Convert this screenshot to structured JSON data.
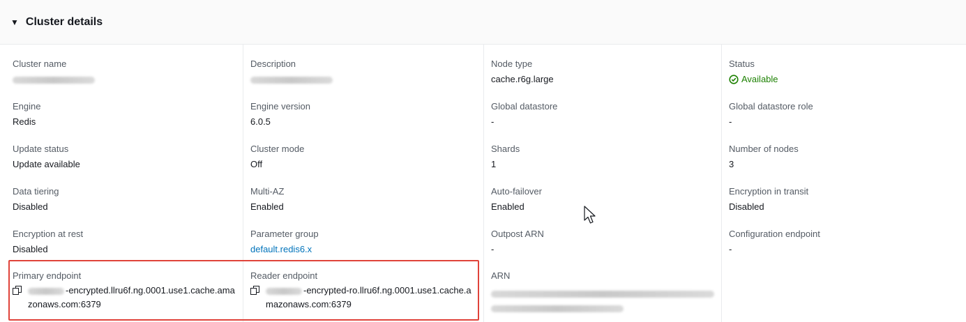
{
  "header": {
    "caret": "▼",
    "title": "Cluster details"
  },
  "columns": [
    {
      "fields": [
        {
          "label": "Cluster name",
          "value": ""
        },
        {
          "label": "Engine",
          "value": "Redis"
        },
        {
          "label": "Update status",
          "value": "Update available"
        },
        {
          "label": "Data tiering",
          "value": "Disabled"
        },
        {
          "label": "Encryption at rest",
          "value": "Disabled"
        },
        {
          "label": "Primary endpoint",
          "value": "-encrypted.llru6f.ng.0001.use1.cache.ama",
          "value2": "zonaws.com:6379"
        }
      ]
    },
    {
      "fields": [
        {
          "label": "Description",
          "value": ""
        },
        {
          "label": "Engine version",
          "value": "6.0.5"
        },
        {
          "label": "Cluster mode",
          "value": "Off"
        },
        {
          "label": "Multi-AZ",
          "value": "Enabled"
        },
        {
          "label": "Parameter group",
          "value": "default.redis6.x"
        },
        {
          "label": "Reader endpoint",
          "value": "-encrypted-ro.llru6f.ng.0001.use1.cache.a",
          "value2": "mazonaws.com:6379"
        }
      ]
    },
    {
      "fields": [
        {
          "label": "Node type",
          "value": "cache.r6g.large"
        },
        {
          "label": "Global datastore",
          "value": "-"
        },
        {
          "label": "Shards",
          "value": "1"
        },
        {
          "label": "Auto-failover",
          "value": "Enabled"
        },
        {
          "label": "Outpost ARN",
          "value": "-"
        },
        {
          "label": "ARN",
          "value": ""
        }
      ]
    },
    {
      "fields": [
        {
          "label": "Status",
          "value": "Available"
        },
        {
          "label": "Global datastore role",
          "value": "-"
        },
        {
          "label": "Number of nodes",
          "value": "3"
        },
        {
          "label": "Encryption in transit",
          "value": "Disabled"
        },
        {
          "label": "Configuration endpoint",
          "value": "-"
        }
      ]
    }
  ],
  "colors": {
    "status_available": "#1d8102",
    "link": "#0073bb",
    "highlight": "#e0433a"
  }
}
